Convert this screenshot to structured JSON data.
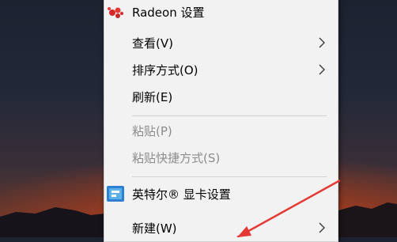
{
  "context_menu": {
    "items": [
      {
        "label": "Radeon 设置",
        "icon": "radeon-icon"
      },
      {
        "label": "查看(V)",
        "submenu": true
      },
      {
        "label": "排序方式(O)",
        "submenu": true
      },
      {
        "label": "刷新(E)"
      },
      {
        "label": "粘贴(P)",
        "disabled": true
      },
      {
        "label": "粘贴快捷方式(S)",
        "disabled": true
      },
      {
        "label": "英特尔® 显卡设置",
        "icon": "intel-graphics-icon"
      },
      {
        "label": "新建(W)",
        "submenu": true
      }
    ]
  },
  "annotation": {
    "color": "#e53935"
  }
}
